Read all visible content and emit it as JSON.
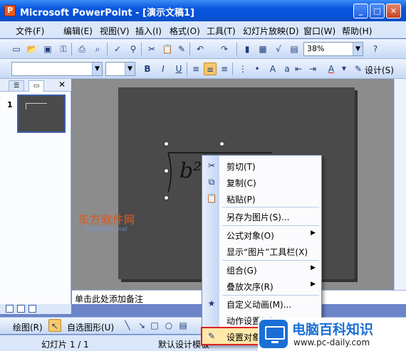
{
  "window": {
    "title": "Microsoft PowerPoint - [演示文稿1]"
  },
  "menu": [
    "文件(F)",
    "编辑(E)",
    "视图(V)",
    "插入(I)",
    "格式(O)",
    "工具(T)",
    "幻灯片放映(D)",
    "窗口(W)",
    "帮助(H)"
  ],
  "toolbar": {
    "zoom": "38%",
    "design_label": "设计(S)"
  },
  "slide_pane": {
    "slide_number": "1"
  },
  "formula": {
    "text": "b²"
  },
  "notes": {
    "placeholder": "单击此处添加备注"
  },
  "context_menu": {
    "items": [
      "剪切(T)",
      "复制(C)",
      "粘贴(P)",
      "另存为图片(S)...",
      "公式对象(O)",
      "显示“图片”工具栏(X)",
      "组合(G)",
      "叠放次序(R)",
      "自定义动画(M)...",
      "动作设置(A)...",
      "设置对象"
    ]
  },
  "drawing": {
    "draw_label": "绘图(R)",
    "autoshape_label": "自选图形(U)"
  },
  "status": {
    "slide": "幻灯片 1 / 1",
    "design": "默认设计模板"
  },
  "watermark": {
    "text": "东方软件网",
    "url": "www.Dfeeu.net"
  },
  "branding": {
    "name": "电脑百科知识",
    "url": "www.pc-daily.com"
  }
}
